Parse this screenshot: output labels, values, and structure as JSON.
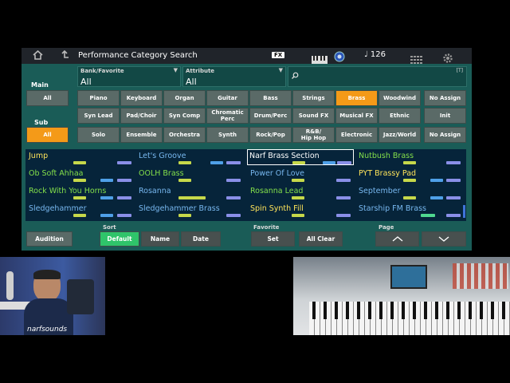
{
  "topbar": {
    "home_icon": "home-icon",
    "back_icon": "back-arrow-icon",
    "title": "Performance Category Search",
    "fx_label": "FX",
    "keyboard_icon": "piano-keys-icon",
    "tempo_icon": "note-icon",
    "tempo": "126",
    "grid_icon": "grid-icon",
    "settings_icon": "gear-icon"
  },
  "filters": {
    "bank_header": "Bank/Favorite",
    "bank_value": "All",
    "attribute_header": "Attribute",
    "attribute_value": "All",
    "search_icon": "search-icon",
    "search_badge": "[T]"
  },
  "main": {
    "label": "Main",
    "all": "All",
    "row1": [
      "Piano",
      "Keyboard",
      "Organ",
      "Guitar",
      "Bass",
      "Strings",
      "Brass",
      "Woodwind"
    ],
    "row2": [
      "Syn Lead",
      "Pad/Choir",
      "Syn Comp",
      "Chromatic Perc",
      "Drum/Perc",
      "Sound FX",
      "Musical FX",
      "Ethnic"
    ],
    "no_assign": "No Assign",
    "init": "Init",
    "selected": "Brass"
  },
  "sub": {
    "label": "Sub",
    "all": "All",
    "row": [
      "Solo",
      "Ensemble",
      "Orchestra",
      "Synth",
      "Rock/Pop",
      "R&B/ Hip Hop",
      "Electronic",
      "Jazz/World"
    ],
    "no_assign": "No Assign"
  },
  "results": [
    [
      "Jump",
      "Let's Groove",
      "Narf Brass Section",
      "Nutbush Brass"
    ],
    [
      "Ob Soft Ahhaa",
      "OOLH Brass",
      "Power Of Love",
      "PYT Brassy Pad"
    ],
    [
      "Rock With You Horns",
      "Rosanna",
      "Rosanna Lead",
      "September"
    ],
    [
      "Sledgehammer",
      "Sledgehammer Brass",
      "Spin Synth Fill",
      "Starship FM Brass"
    ]
  ],
  "selected_result": "Narf Brass Section",
  "bottom": {
    "audition": "Audition",
    "sort_header": "Sort",
    "sort_default": "Default",
    "sort_name": "Name",
    "sort_date": "Date",
    "favorite_header": "Favorite",
    "fav_set": "Set",
    "fav_clear": "All Clear",
    "page_header": "Page",
    "page_up_icon": "chevron-up-icon",
    "page_down_icon": "chevron-down-icon"
  },
  "webcam": {
    "caption": "narfsounds"
  },
  "colors": {
    "accent": "#f49a18",
    "sort_active": "#2fc46a",
    "panel": "#1a5c57"
  }
}
